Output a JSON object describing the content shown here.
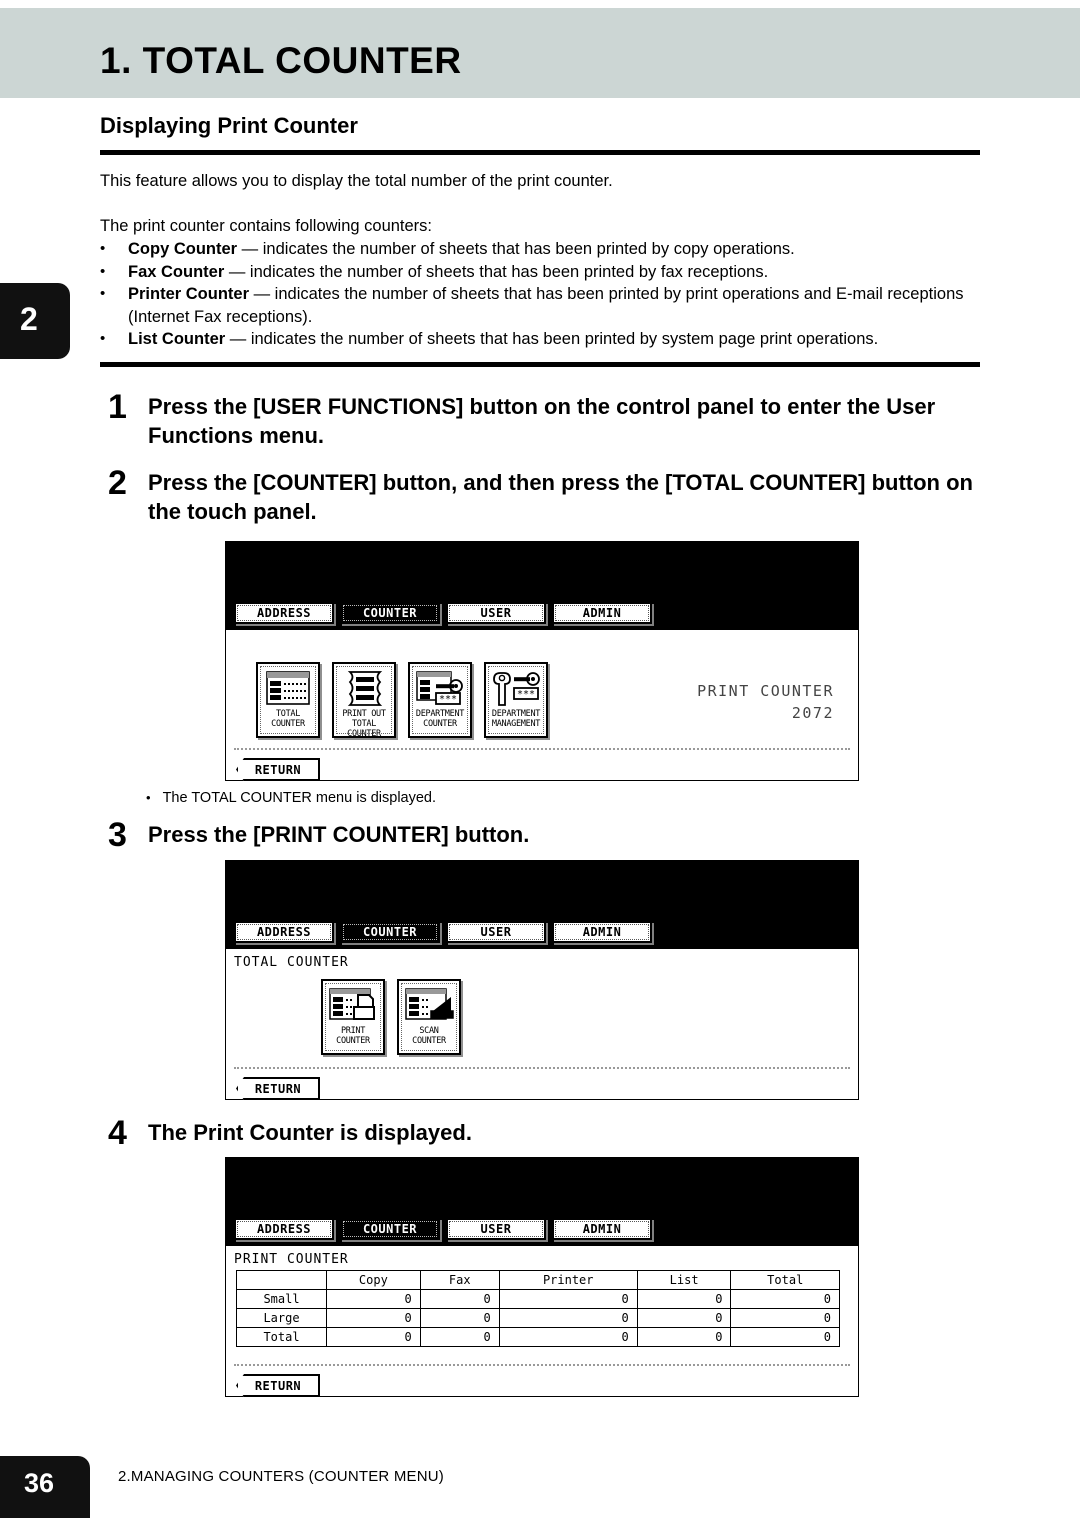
{
  "page": {
    "chapter_marker": "2",
    "chapter_title": "1. TOTAL COUNTER",
    "section_heading": "Displaying Print Counter",
    "page_number": "36",
    "footer_text": "2.MANAGING COUNTERS (COUNTER MENU)"
  },
  "body": {
    "intro": "This feature allows you to display the total number of the print counter.",
    "contains_lead": "The print counter contains following counters:",
    "bullet_marker": "•",
    "bullets": [
      {
        "term": "Copy Counter",
        "desc": " — indicates the number of sheets that has been printed by copy operations."
      },
      {
        "term": "Fax Counter",
        "desc": " — indicates the number of sheets that has been printed by fax receptions."
      },
      {
        "term": "Printer Counter",
        "desc": " — indicates the number of sheets that has been printed by print operations and E-mail receptions (Internet Fax receptions)."
      },
      {
        "term": "List Counter",
        "desc": " — indicates the number of sheets that has been printed by system page print operations."
      }
    ]
  },
  "steps": [
    {
      "num": "1",
      "text": "Press the [USER FUNCTIONS] button on the control panel to enter the User Functions menu."
    },
    {
      "num": "2",
      "text": "Press the [COUNTER] button, and then press the [TOTAL COUNTER] button on the touch panel."
    },
    {
      "num": "3",
      "text": "Press the [PRINT COUNTER] button."
    },
    {
      "num": "4",
      "text": "The Print Counter is displayed."
    }
  ],
  "notes": [
    {
      "marker": "•",
      "text": "The TOTAL COUNTER menu is displayed."
    }
  ],
  "lcd_tabs": [
    "ADDRESS",
    "COUNTER",
    "USER",
    "ADMIN"
  ],
  "lcd_active_tab": "COUNTER",
  "panel1": {
    "buttons": [
      {
        "icon": "total-counter-icon",
        "caption": "TOTAL\nCOUNTER"
      },
      {
        "icon": "print-out-total-counter-icon",
        "caption": "PRINT OUT\nTOTAL COUNTER"
      },
      {
        "icon": "department-counter-icon",
        "caption": "DEPARTMENT\nCOUNTER"
      },
      {
        "icon": "department-management-icon",
        "caption": "DEPARTMENT\nMANAGEMENT"
      }
    ],
    "readout_label": "PRINT COUNTER",
    "readout_value": "2072",
    "return_label": "RETURN"
  },
  "panel2": {
    "breadcrumb": "TOTAL COUNTER",
    "buttons": [
      {
        "icon": "print-counter-icon",
        "caption": "PRINT\nCOUNTER"
      },
      {
        "icon": "scan-counter-icon",
        "caption": "SCAN\nCOUNTER"
      }
    ],
    "return_label": "RETURN"
  },
  "panel3": {
    "breadcrumb": "PRINT COUNTER",
    "return_label": "RETURN",
    "table": {
      "corner": "",
      "columns": [
        "Copy",
        "Fax",
        "Printer",
        "List",
        "Total"
      ],
      "rows": [
        {
          "label": "Small",
          "values": [
            "0",
            "0",
            "0",
            "0",
            "0"
          ]
        },
        {
          "label": "Large",
          "values": [
            "0",
            "0",
            "0",
            "0",
            "0"
          ]
        },
        {
          "label": "Total",
          "values": [
            "0",
            "0",
            "0",
            "0",
            "0"
          ]
        }
      ]
    }
  },
  "colors": {
    "header_band": "#ccd6d4",
    "tab_black": "#111111",
    "rule": "#000000"
  }
}
